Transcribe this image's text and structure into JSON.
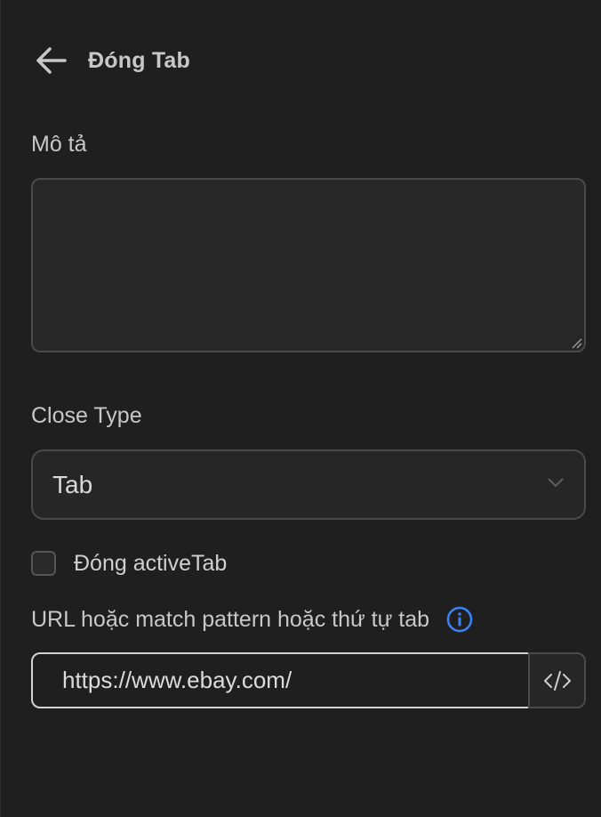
{
  "header": {
    "title": "Đóng Tab",
    "back_icon": "arrow-left-icon"
  },
  "description": {
    "label": "Mô tả",
    "value": ""
  },
  "close_type": {
    "label": "Close Type",
    "selected": "Tab"
  },
  "active_tab": {
    "label": "Đóng activeTab",
    "checked": false
  },
  "url_field": {
    "label": "URL hoặc match pattern hoặc thứ tự tab",
    "value": "https://www.ebay.com/",
    "info_icon": "info-icon",
    "code_icon": "code-icon"
  },
  "colors": {
    "background": "#1f1f1f",
    "accent": "#3b82f6",
    "border": "#4a4a4a"
  }
}
